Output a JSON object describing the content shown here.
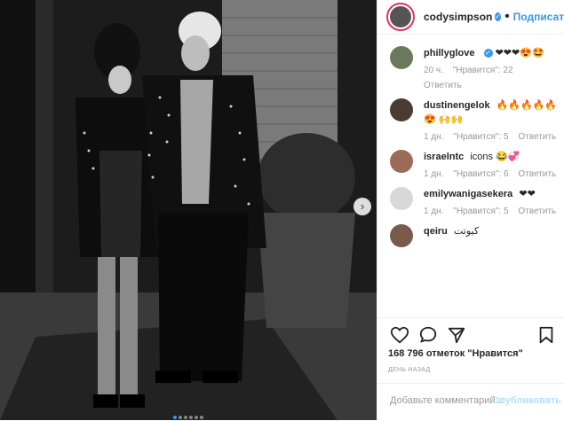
{
  "post": {
    "photo_alt": "",
    "carousel": {
      "count": 6,
      "active": 1
    }
  },
  "header": {
    "username": "codysimpson",
    "verified_mark": "✓",
    "separator": "•",
    "follow_label": "Подписаться"
  },
  "comments": [
    {
      "user": "phillyglove",
      "verified": true,
      "text": "❤❤❤😍🤩",
      "time": "20 ч.",
      "likes": "\"Нравится\": 22",
      "reply": "Ответить",
      "replies": "",
      "avatar_color": "#6b7a5d"
    },
    {
      "user": "dustinengelok",
      "verified": false,
      "text": "🔥🔥🔥🔥🔥😍 🙌🙌",
      "time": "1 дн.",
      "likes": "\"Нравится\": 5",
      "reply": "Ответить",
      "replies": "",
      "avatar_color": "#4a3b33"
    },
    {
      "user": "israelntc",
      "verified": false,
      "text": "icons 😂💞",
      "time": "1 дн.",
      "likes": "\"Нравится\": 6",
      "reply": "Ответить",
      "replies": "",
      "avatar_color": "#9b6b59"
    },
    {
      "user": "emilywanigasekera",
      "verified": false,
      "text": "❤❤",
      "time": "1 дн.",
      "likes": "\"Нравится\": 5",
      "reply": "Ответить",
      "replies": "",
      "avatar_color": "#d8d8d8"
    },
    {
      "user": "qeiru",
      "verified": false,
      "text": "كيوتت",
      "time": "",
      "likes": "",
      "reply": "",
      "replies": "",
      "avatar_color": "#7a5a4a"
    }
  ],
  "stats": {
    "likes_label": "168 796 отметок \"Нравится\"",
    "time_ago": "ДЕНЬ НАЗАД"
  },
  "add_comment": {
    "placeholder": "Добавьте комментарий...",
    "publish_label": "Опубликовать"
  },
  "icons": {
    "like": "heart-icon",
    "comment": "comment-icon",
    "share": "share-icon",
    "save": "bookmark-icon",
    "next": "chevron-right-icon"
  },
  "colors": {
    "accent": "#3897f0",
    "avatar_ring": "#e1306c"
  }
}
